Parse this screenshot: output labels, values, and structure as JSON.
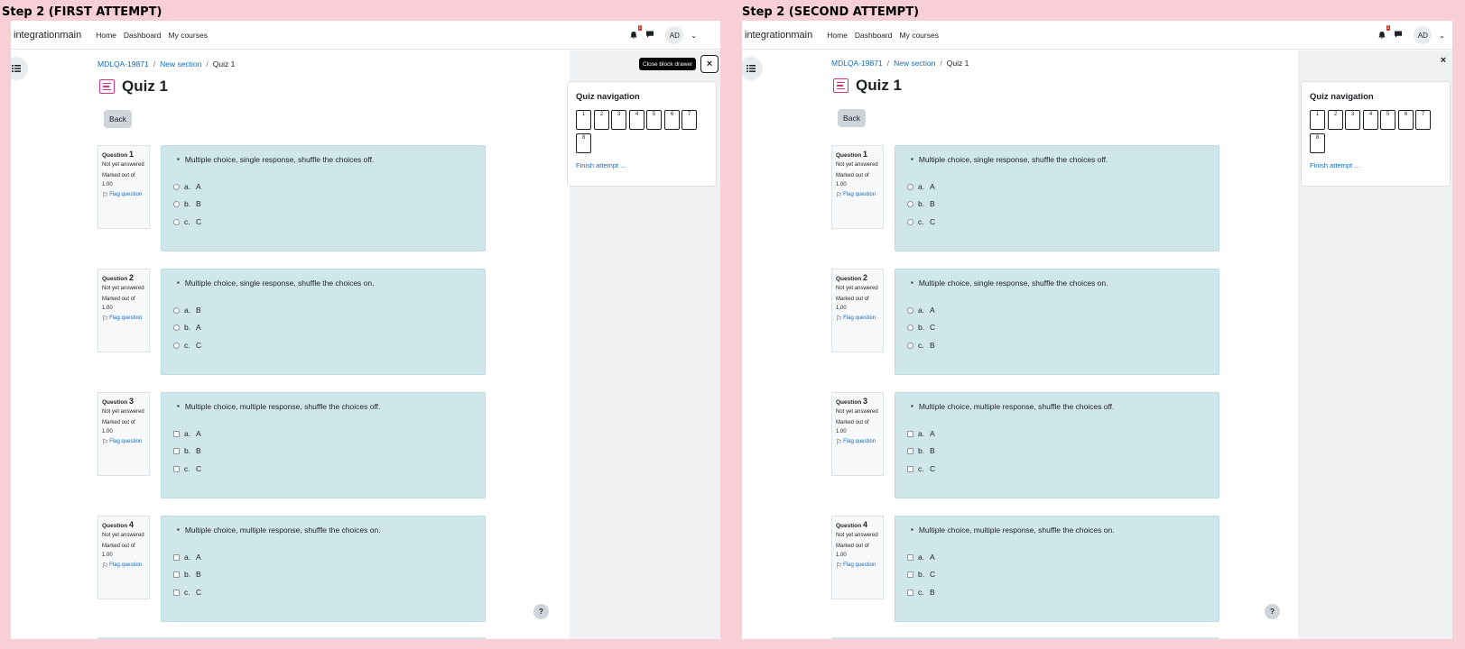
{
  "steps": [
    {
      "title": "Step 2 (FIRST ATTEMPT)",
      "tooltip": "Close block drawer",
      "questions": [
        {
          "num": "1",
          "text": "Multiple choice, single response, shuffle the choices off.",
          "input": "radio",
          "answers": [
            {
              "letter": "a.",
              "text": "A"
            },
            {
              "letter": "b.",
              "text": "B"
            },
            {
              "letter": "c.",
              "text": "C"
            }
          ]
        },
        {
          "num": "2",
          "text": "Multiple choice, single response, shuffle the choices on.",
          "input": "radio",
          "answers": [
            {
              "letter": "a.",
              "text": "B"
            },
            {
              "letter": "b.",
              "text": "A"
            },
            {
              "letter": "c.",
              "text": "C"
            }
          ]
        },
        {
          "num": "3",
          "text": "Multiple choice, multiple response, shuffle the choices off.",
          "input": "checkbox",
          "answers": [
            {
              "letter": "a.",
              "text": "A"
            },
            {
              "letter": "b.",
              "text": "B"
            },
            {
              "letter": "c.",
              "text": "C"
            }
          ]
        },
        {
          "num": "4",
          "text": "Multiple choice, multiple response, shuffle the choices on.",
          "input": "checkbox",
          "answers": [
            {
              "letter": "a.",
              "text": "A"
            },
            {
              "letter": "b.",
              "text": "B"
            },
            {
              "letter": "c.",
              "text": "C"
            }
          ]
        }
      ]
    },
    {
      "title": "Step 2 (SECOND ATTEMPT)",
      "tooltip": "",
      "questions": [
        {
          "num": "1",
          "text": "Multiple choice, single response, shuffle the choices off.",
          "input": "radio",
          "answers": [
            {
              "letter": "a.",
              "text": "A"
            },
            {
              "letter": "b.",
              "text": "B"
            },
            {
              "letter": "c.",
              "text": "C"
            }
          ]
        },
        {
          "num": "2",
          "text": "Multiple choice, single response, shuffle the choices on.",
          "input": "radio",
          "answers": [
            {
              "letter": "a.",
              "text": "A"
            },
            {
              "letter": "b.",
              "text": "C"
            },
            {
              "letter": "c.",
              "text": "B"
            }
          ]
        },
        {
          "num": "3",
          "text": "Multiple choice, multiple response, shuffle the choices off.",
          "input": "checkbox",
          "answers": [
            {
              "letter": "a.",
              "text": "A"
            },
            {
              "letter": "b.",
              "text": "B"
            },
            {
              "letter": "c.",
              "text": "C"
            }
          ]
        },
        {
          "num": "4",
          "text": "Multiple choice, multiple response, shuffle the choices on.",
          "input": "checkbox",
          "answers": [
            {
              "letter": "a.",
              "text": "A"
            },
            {
              "letter": "b.",
              "text": "C"
            },
            {
              "letter": "c.",
              "text": "B"
            }
          ]
        }
      ]
    }
  ],
  "navbar": {
    "brand": "integrationmain",
    "links": [
      "Home",
      "Dashboard",
      "My courses"
    ],
    "notification_count": "1",
    "avatar": "AD"
  },
  "breadcrumb": [
    "MDLQA-19871",
    "New section",
    "Quiz 1"
  ],
  "page_title": "Quiz 1",
  "back_label": "Back",
  "question_label": "Question",
  "not_yet_answered": "Not yet answered",
  "marked_out_of": "Marked out of 1.00",
  "flag_label": "Flag question",
  "quiz_nav": {
    "title": "Quiz navigation",
    "buttons": [
      "1",
      "2",
      "3",
      "4",
      "5",
      "6",
      "7",
      "8"
    ],
    "finish": "Finish attempt ..."
  },
  "icons": {
    "drawer": "list-icon",
    "bell": "bell-icon",
    "chat": "chat-icon",
    "close": "close-icon",
    "help": "help-icon",
    "flag": "flag-icon",
    "quiz": "quiz-icon"
  },
  "colors": {
    "background": "#f8cfd6",
    "question_bg": "#cfe6ea",
    "link": "#0f6cbf",
    "quiz_icon": "#d63384",
    "badge": "#ca3120"
  }
}
